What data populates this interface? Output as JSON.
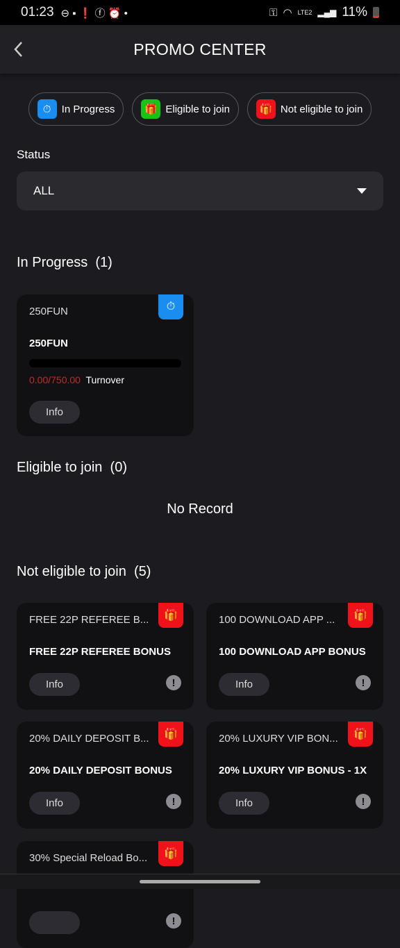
{
  "status_bar": {
    "time": "01:23",
    "battery": "11%",
    "network": "LTE2"
  },
  "header": {
    "title": "PROMO CENTER"
  },
  "legend": [
    {
      "label": "In Progress",
      "icon": "stopwatch-icon",
      "color": "#1a8ef0"
    },
    {
      "label": "Eligible to join",
      "icon": "gift-icon",
      "color": "#16c316"
    },
    {
      "label": "Not eligible to join",
      "icon": "gift-icon",
      "color": "#f0121a"
    }
  ],
  "filter": {
    "label": "Status",
    "value": "ALL"
  },
  "in_progress": {
    "title": "In Progress",
    "count": "(1)",
    "items": [
      {
        "short": "250FUN",
        "name": "250FUN",
        "progress": 0,
        "current": "0.00/750.00",
        "unit": "Turnover",
        "info": "Info"
      }
    ]
  },
  "eligible": {
    "title": "Eligible to join",
    "count": "(0)",
    "empty": "No Record"
  },
  "not_eligible": {
    "title": "Not eligible to join",
    "count": "(5)",
    "items": [
      {
        "short": "FREE 22P REFEREE B...",
        "name": "FREE 22P REFEREE BONUS",
        "info": "Info"
      },
      {
        "short": "100 DOWNLOAD APP ...",
        "name": "100 DOWNLOAD APP BONUS",
        "info": "Info"
      },
      {
        "short": "20% DAILY DEPOSIT B...",
        "name": "20% DAILY DEPOSIT BONUS",
        "info": "Info"
      },
      {
        "short": "20% LUXURY VIP BON...",
        "name": "20% LUXURY VIP BONUS - 1X",
        "info": "Info"
      },
      {
        "short": "30% Special Reload Bo...",
        "name": "",
        "info": ""
      }
    ]
  }
}
